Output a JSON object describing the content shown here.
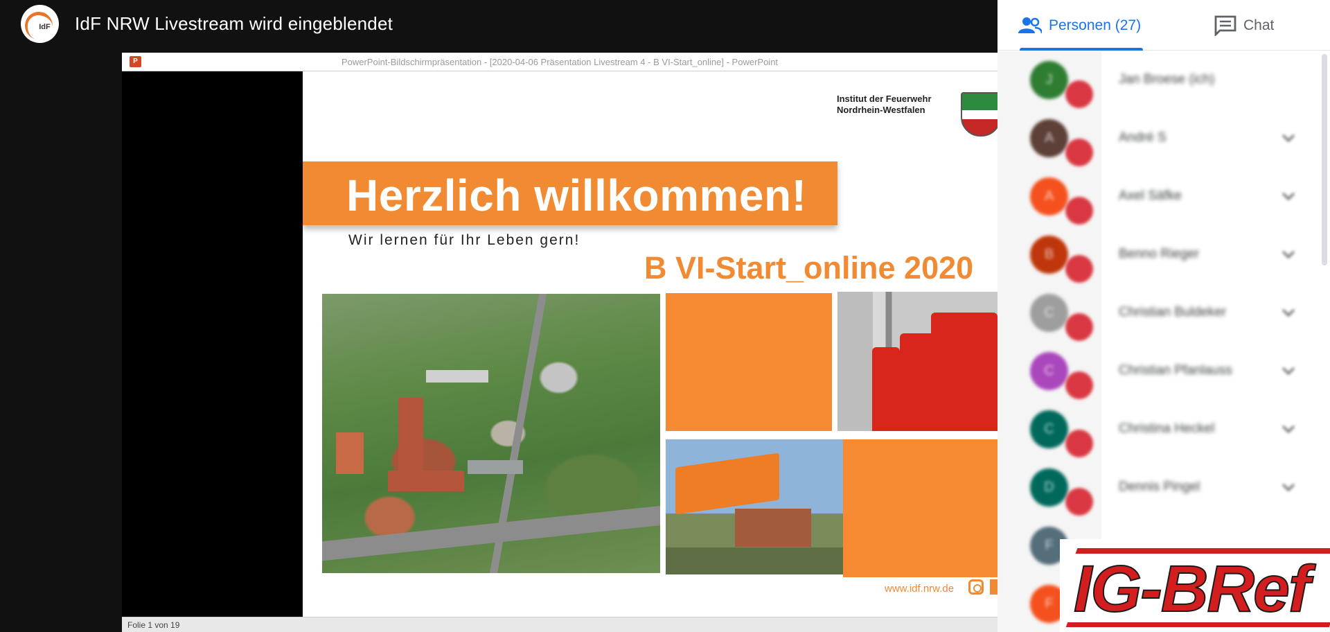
{
  "header": {
    "logo_text": "IdF",
    "meeting_title": "IdF NRW Livestream wird eingeblendet"
  },
  "presentation": {
    "window_title": "PowerPoint-Bildschirmpräsentation - [2020-04-06 Präsentation Livestream 4 - B VI-Start_online] - PowerPoint",
    "app_icon_label": "P",
    "status_text": "Folie 1 von 19",
    "slide": {
      "institute_line1": "Institut der Feuerwehr",
      "institute_line2": "Nordrhein-Westfalen",
      "headline": "Herzlich willkommen!",
      "tagline": "Wir lernen für Ihr Leben gern!",
      "course_title": "B VI-Start_online 2020",
      "website": "www.idf.nrw.de"
    },
    "colors": {
      "accent_orange": "#f08a33"
    }
  },
  "panel": {
    "tabs": [
      {
        "label": "Personen (27)",
        "icon": "people-icon",
        "active": true
      },
      {
        "label": "Chat",
        "icon": "chat-icon",
        "active": false
      }
    ],
    "participants": [
      {
        "initial": "J",
        "name": "Jan Broese (ich)",
        "color": "#2e7d32",
        "has_menu": false
      },
      {
        "initial": "A",
        "name": "André S",
        "color": "#5d4037",
        "has_menu": true
      },
      {
        "initial": "A",
        "name": "Axel Säfke",
        "color": "#f4511e",
        "has_menu": true
      },
      {
        "initial": "B",
        "name": "Benno Rieger",
        "color": "#bf360c",
        "has_menu": true
      },
      {
        "initial": "C",
        "name": "Christian Buldeker",
        "color": "#9e9e9e",
        "has_menu": true
      },
      {
        "initial": "C",
        "name": "Christian Pfanlauss",
        "color": "#ab47bc",
        "has_menu": true
      },
      {
        "initial": "C",
        "name": "Christina Heckel",
        "color": "#00695c",
        "has_menu": true
      },
      {
        "initial": "D",
        "name": "Dennis Pingel",
        "color": "#00695c",
        "has_menu": true
      },
      {
        "initial": "F",
        "name": "",
        "color": "#546e7a",
        "has_menu": false
      },
      {
        "initial": "F",
        "name": "",
        "color": "#f4511e",
        "has_menu": false
      }
    ],
    "colors": {
      "active_tab": "#1a73e8",
      "badge": "#d93842"
    }
  },
  "watermark": {
    "text": "IG-BRef"
  }
}
